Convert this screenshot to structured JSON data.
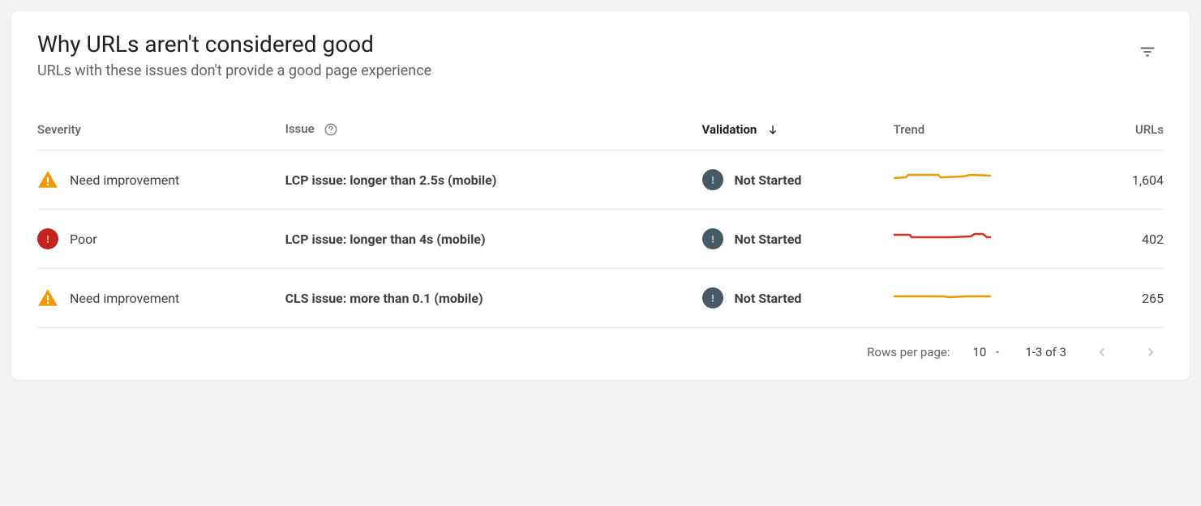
{
  "header": {
    "title": "Why URLs aren't considered good",
    "subtitle": "URLs with these issues don't provide a good page experience"
  },
  "columns": {
    "severity": "Severity",
    "issue": "Issue",
    "validation": "Validation",
    "trend": "Trend",
    "urls": "URLs"
  },
  "rows": [
    {
      "severity_code": "need_improvement",
      "severity": "Need improvement",
      "issue": "LCP issue: longer than 2.5s (mobile)",
      "validation": "Not Started",
      "trend_color": "#f29900",
      "urls": "1,604"
    },
    {
      "severity_code": "poor",
      "severity": "Poor",
      "issue": "LCP issue: longer than 4s (mobile)",
      "validation": "Not Started",
      "trend_color": "#d93025",
      "urls": "402"
    },
    {
      "severity_code": "need_improvement",
      "severity": "Need improvement",
      "issue": "CLS issue: more than 0.1 (mobile)",
      "validation": "Not Started",
      "trend_color": "#f29900",
      "urls": "265"
    }
  ],
  "pagination": {
    "rows_label": "Rows per page:",
    "rows_value": "10",
    "range": "1-3 of 3"
  }
}
